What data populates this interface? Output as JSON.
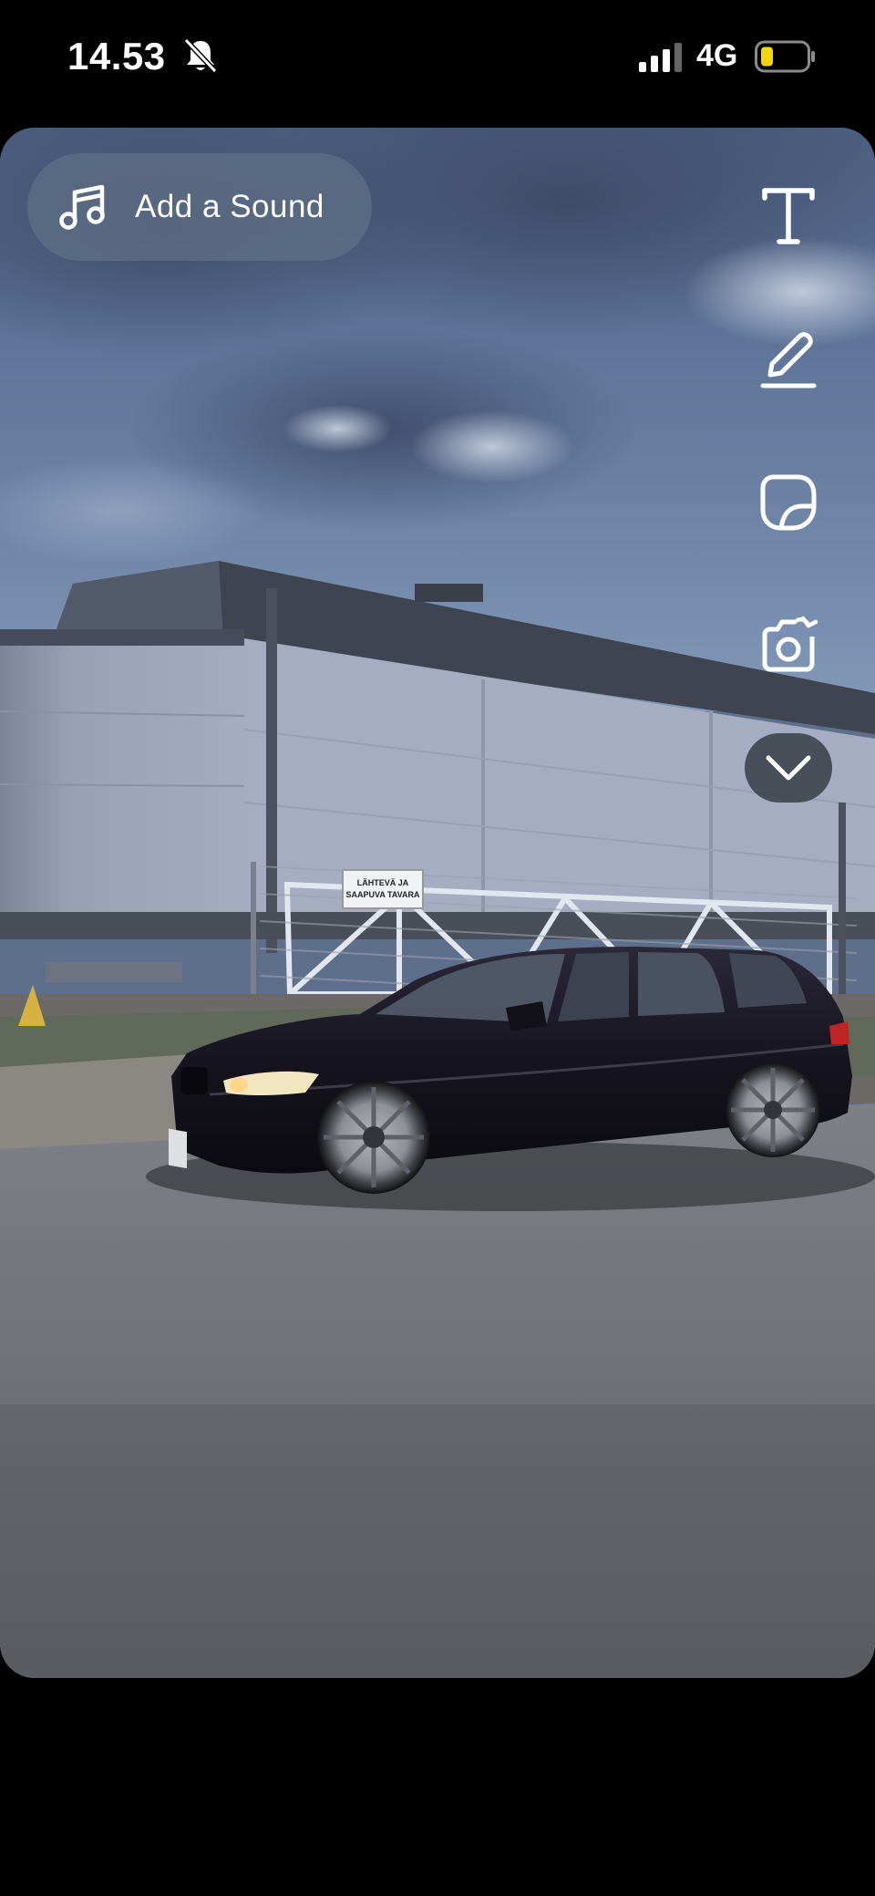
{
  "status_bar": {
    "time": "14.53",
    "network": "4G",
    "icons": [
      "bell-muted-icon",
      "cellular-signal-icon",
      "battery-icon"
    ],
    "battery_color": "#f4d40f"
  },
  "editor": {
    "add_sound_label": "Add a Sound",
    "tools": [
      "text-tool-icon",
      "draw-tool-icon",
      "sticker-tool-icon",
      "camera-tool-icon",
      "chevron-down-icon"
    ]
  },
  "photo": {
    "sign_line1": "LÄHTEVÄ JA",
    "sign_line2": "SAAPUVA TAVARA"
  }
}
